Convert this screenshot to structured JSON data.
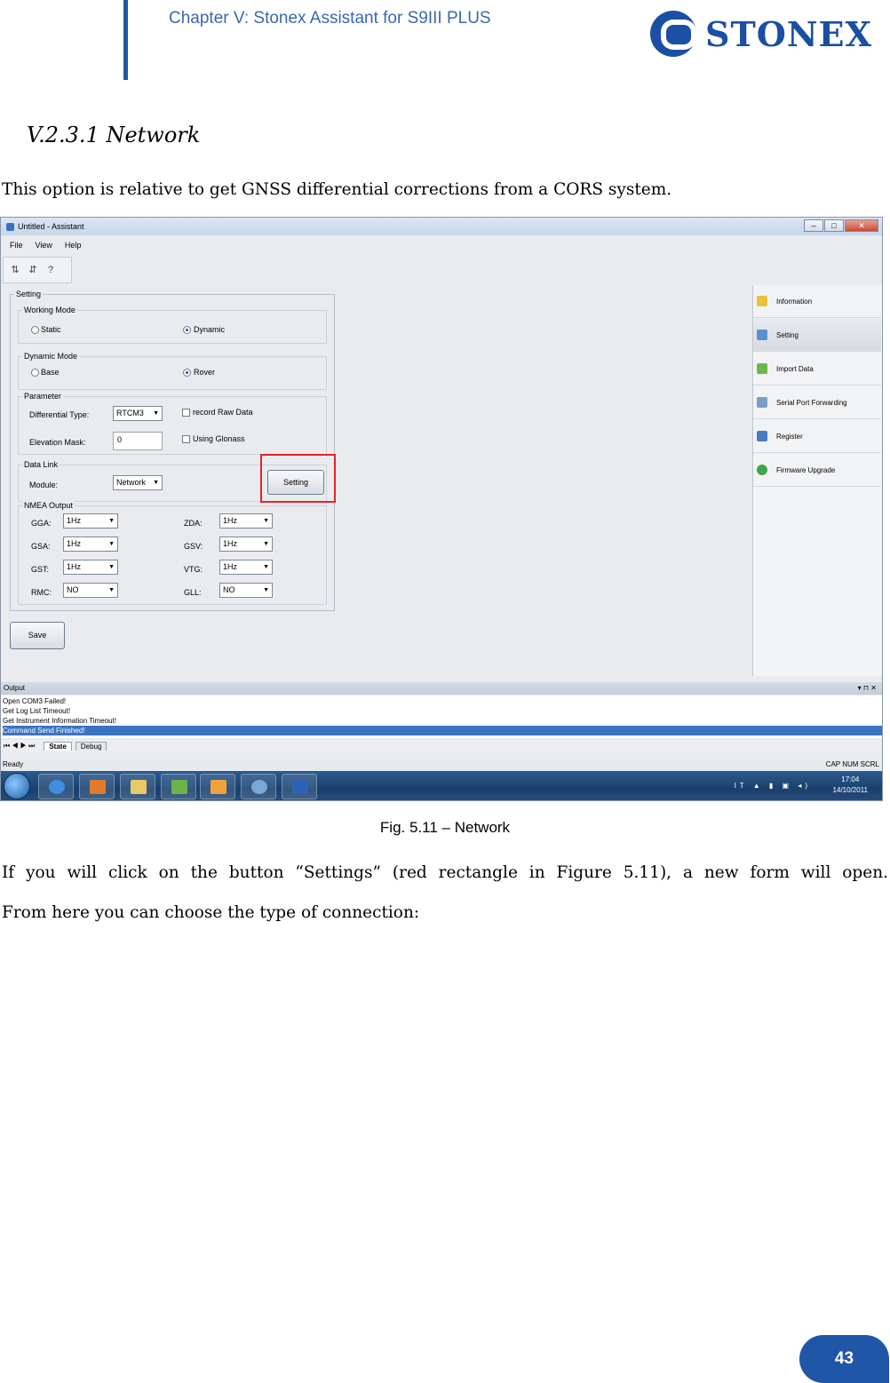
{
  "header": {
    "chapter": "Chapter V: Stonex Assistant for S9III PLUS",
    "brand": "STONEX"
  },
  "section": {
    "title": "V.2.3.1  Network",
    "intro": "This option is relative to get GNSS differential corrections from a CORS system."
  },
  "screenshot": {
    "window_title": "Untitled - Assistant",
    "menu": [
      "File",
      "View",
      "Help"
    ],
    "setting_group": "Setting",
    "working_mode": {
      "legend": "Working Mode",
      "static": "Static",
      "dynamic": "Dynamic"
    },
    "dynamic_mode": {
      "legend": "Dynamic Mode",
      "base": "Base",
      "rover": "Rover"
    },
    "parameter": {
      "legend": "Parameter",
      "diff_type_label": "Differential Type:",
      "diff_type_value": "RTCM3",
      "record_raw": "record Raw Data",
      "elev_mask_label": "Elevation Mask:",
      "elev_mask_value": "0",
      "using_glonass": "Using Glonass"
    },
    "data_link": {
      "legend": "Data Link",
      "module_label": "Module:",
      "module_value": "Network",
      "setting_button": "Setting"
    },
    "nmea": {
      "legend": "NMEA Output",
      "gga": "GGA:",
      "gga_v": "1Hz",
      "gsa": "GSA:",
      "gsa_v": "1Hz",
      "gst": "GST:",
      "gst_v": "1Hz",
      "rmc": "RMC:",
      "rmc_v": "NO",
      "zda": "ZDA:",
      "zda_v": "1Hz",
      "gsv": "GSV:",
      "gsv_v": "1Hz",
      "vtg": "VTG:",
      "vtg_v": "1Hz",
      "gll": "GLL:",
      "gll_v": "NO"
    },
    "save_button": "Save",
    "right_panel": [
      "Information",
      "Setting",
      "Import Data",
      "Serial Port Forwarding",
      "Register",
      "Firmware Upgrade"
    ],
    "output": {
      "title": "Output",
      "lines": [
        "Open COM3 Failed!",
        "Get Log List Timeout!",
        "Get Instrument Information Timeout!",
        "Command Send Finished!"
      ],
      "tabs": [
        "State",
        "Debug"
      ]
    },
    "status": {
      "left": "Ready",
      "right": "CAP  NUM  SCRL"
    },
    "taskbar": {
      "lang": "IT",
      "time": "17:04",
      "date": "14/10/2011"
    }
  },
  "figure_caption": "Fig. 5.11 – Network",
  "body": {
    "para1": "If you will click on the button “Settings” (red rectangle in Figure 5.11), a new form will open.",
    "para2": "From here you can choose the type of connection:"
  },
  "page_number": "43",
  "colors": {
    "brand_blue": "#1f56a8",
    "highlight_red": "#e0242b"
  }
}
